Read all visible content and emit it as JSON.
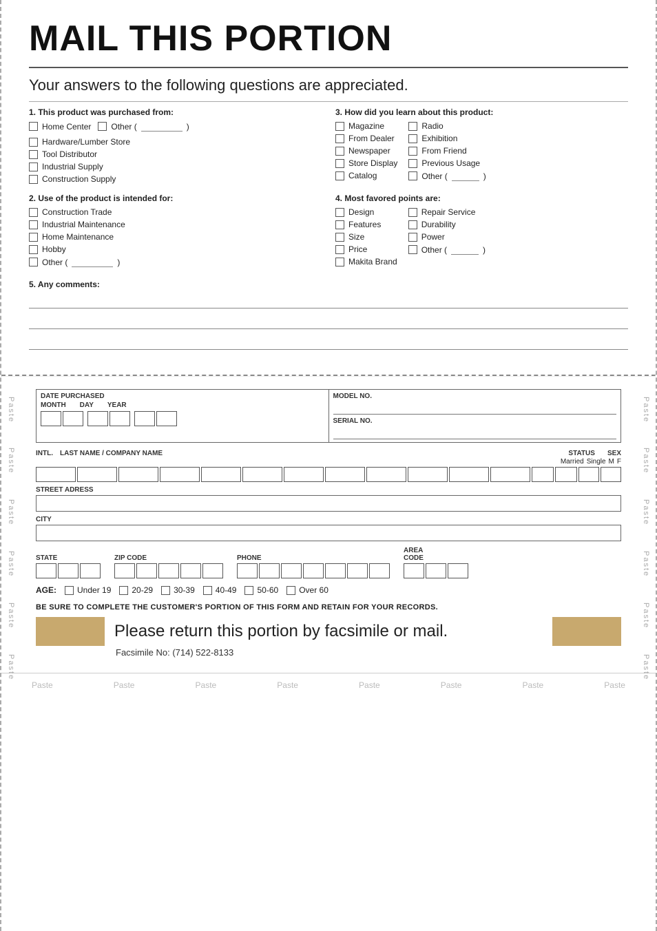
{
  "title": "MAIL THIS PORTION",
  "subtitle": "Your answers to the following questions are appreciated.",
  "question1": {
    "title": "1. This product was purchased from:",
    "items": [
      "Home Center",
      "Hardware/Lumber Store",
      "Tool Distributor",
      "Industrial Supply",
      "Construction Supply"
    ],
    "other_label": "Other (",
    "other_close": ")"
  },
  "question2": {
    "title": "2. Use of the product is intended for:",
    "items": [
      "Construction Trade",
      "Industrial Maintenance",
      "Home Maintenance",
      "Hobby"
    ],
    "other_label": "Other (",
    "other_close": ")"
  },
  "question3": {
    "title": "3. How did you learn about this product:",
    "col1": [
      "Magazine",
      "From Dealer",
      "Newspaper",
      "Store Display",
      "Catalog"
    ],
    "col2": [
      "Radio",
      "Exhibition",
      "From Friend",
      "Previous Usage"
    ],
    "other_label": "Other (",
    "other_close": ")"
  },
  "question4": {
    "title": "4. Most favored points are:",
    "col1": [
      "Design",
      "Features",
      "Size",
      "Price",
      "Makita Brand"
    ],
    "col2": [
      "Repair Service",
      "Durability",
      "Power"
    ],
    "other_label": "Other (",
    "other_close": ")"
  },
  "question5": {
    "title": "5. Any comments:"
  },
  "form": {
    "date_purchased": "DATE PURCHASED",
    "month_label": "MONTH",
    "day_label": "DAY",
    "year_label": "YEAR",
    "model_label": "MODEL NO.",
    "serial_label": "SERIAL NO.",
    "intl_label": "INTL.",
    "name_label": "LAST NAME / COMPANY NAME",
    "status_label": "STATUS",
    "sex_label": "SEX",
    "married_label": "Married",
    "single_label": "Single",
    "m_label": "M",
    "f_label": "F",
    "street_label": "STREET ADRESS",
    "city_label": "CITY",
    "state_label": "STATE",
    "zip_label": "ZIP CODE",
    "phone_label": "PHONE",
    "area_label": "AREA\nCODE",
    "age_label": "AGE:",
    "age_options": [
      "Under 19",
      "20-29",
      "30-39",
      "40-49",
      "50-60",
      "Over 60"
    ]
  },
  "retain_notice": "BE SURE TO COMPLETE THE CUSTOMER'S PORTION OF THIS FORM AND RETAIN FOR YOUR RECORDS.",
  "return_text": "Please return this portion by facsimile or mail.",
  "fax_text": "Facsimile No: (714) 522-8133",
  "paste_labels": [
    "Paste",
    "Paste",
    "Paste",
    "Paste",
    "Paste",
    "Paste",
    "Paste",
    "Paste"
  ],
  "side_paste_labels": [
    "Paste",
    "Paste",
    "Paste",
    "Paste",
    "Paste",
    "Paste"
  ]
}
